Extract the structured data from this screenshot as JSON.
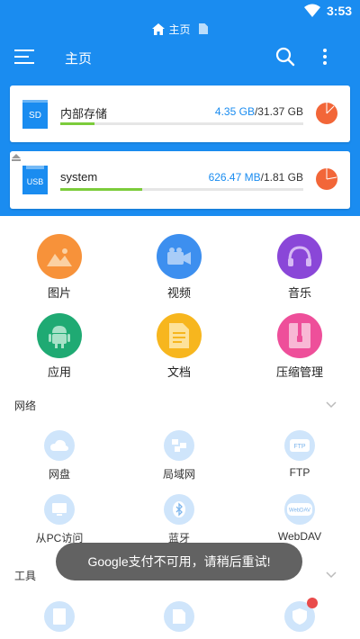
{
  "status_bar": {
    "time": "3:53"
  },
  "breadcrumb": {
    "label": "主页"
  },
  "toolbar": {
    "title": "主页"
  },
  "storage": [
    {
      "name": "内部存储",
      "used": "4.35 GB",
      "total": "/31.37 GB",
      "used_fraction": 0.139,
      "device_label": "SD"
    },
    {
      "name": "system",
      "used": "626.47 MB",
      "total": "/1.81 GB",
      "used_fraction": 0.338,
      "device_label": "USB"
    }
  ],
  "categories": [
    {
      "label": "图片",
      "color": "#f7923a"
    },
    {
      "label": "视频",
      "color": "#3d8fef"
    },
    {
      "label": "音乐",
      "color": "#8a47d8"
    },
    {
      "label": "应用",
      "color": "#1faa73"
    },
    {
      "label": "文档",
      "color": "#f7b61e"
    },
    {
      "label": "压缩管理",
      "color": "#ee4f9a"
    }
  ],
  "network_section": {
    "title": "网络",
    "items": [
      {
        "label": "网盘"
      },
      {
        "label": "局域网"
      },
      {
        "label": "FTP",
        "icon_text": "FTP"
      },
      {
        "label": "从PC访问"
      },
      {
        "label": "蓝牙"
      },
      {
        "label": "WebDAV",
        "icon_text": "WebDAV"
      }
    ]
  },
  "tools_section": {
    "title": "工具"
  },
  "toast": {
    "message": "Google支付不可用，请稍后重试!"
  },
  "colors": {
    "primary": "#1a8cf0",
    "bar_fill": "#7ccc3b",
    "pie": "#f26638"
  }
}
